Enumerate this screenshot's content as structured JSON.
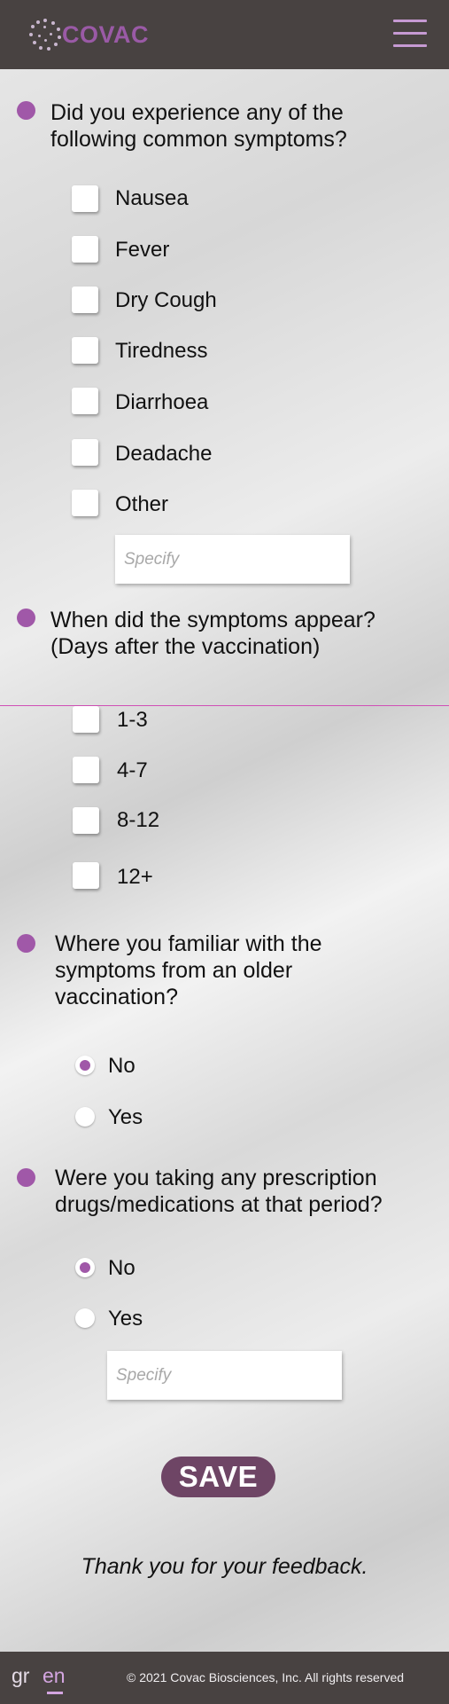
{
  "colors": {
    "accent": "#a058a8",
    "header_bg": "#484241",
    "save_bg": "#6e4565",
    "divider": "#d04fb6"
  },
  "header": {
    "logo_text": "COVAC",
    "menu_icon": "hamburger-menu-icon"
  },
  "q1": {
    "question": "Did you experience any of the following common symptoms?",
    "options": [
      "Nausea",
      "Fever",
      "Dry Cough",
      "Tiredness",
      "Diarrhoea",
      "Deadache",
      "Other"
    ],
    "specify_placeholder": "Specify"
  },
  "q2": {
    "question": "When did the symptoms appear? (Days after the vaccination)",
    "options": [
      "1-3",
      "4-7",
      "8-12",
      "12+"
    ]
  },
  "q3": {
    "question": "Where you familiar with the symptoms from an older vaccination?",
    "options": [
      "No",
      "Yes"
    ],
    "selected": "No"
  },
  "q4": {
    "question": "Were you taking any prescription drugs/medications at that period?",
    "options": [
      "No",
      "Yes"
    ],
    "selected": "No",
    "specify_placeholder": "Specify"
  },
  "save_label": "SAVE",
  "thanks": "Thank you for your feedback.",
  "footer": {
    "lang_gr": "gr",
    "lang_en": "en",
    "active_lang": "en",
    "copyright": "© 2021 Covac Biosciences, Inc. All rights reserved"
  }
}
